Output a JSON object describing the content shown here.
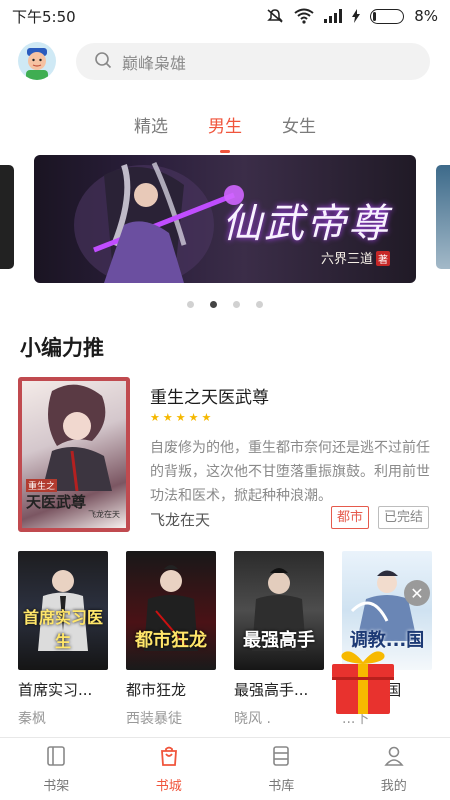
{
  "status_bar": {
    "time": "下午5:50",
    "battery": "8%"
  },
  "search": {
    "placeholder": "巅峰枭雄"
  },
  "tabs": [
    {
      "label": "精选",
      "active": false
    },
    {
      "label": "男生",
      "active": true
    },
    {
      "label": "女生",
      "active": false
    }
  ],
  "banner": {
    "title": "仙武帝尊",
    "subtitle": "六界三道",
    "seal": "著",
    "slides": 4,
    "active_slide": 2
  },
  "section": {
    "title": "小编力推"
  },
  "featured": {
    "title": "重生之天医武尊",
    "rating_stars": 5,
    "description": "自废修为的他，重生都市奈何还是逃不过前任的背叛，这次他不甘堕落重振旗鼓。利用前世功法和医术，掀起种种浪潮。",
    "author": "飞龙在天",
    "tags": [
      "都市",
      "已完结"
    ],
    "cover": {
      "tag": "重生之",
      "title": "天医武尊",
      "author": "飞龙在天"
    }
  },
  "books": [
    {
      "name": "首席实习...",
      "author": "秦枫",
      "cover_text": "首席实习医生"
    },
    {
      "name": "都市狂龙",
      "author": "西装暴徒",
      "cover_text": "都市狂龙"
    },
    {
      "name": "最强高手...",
      "author": "晓风 .",
      "cover_text": "最强高手"
    },
    {
      "name": "调教...国",
      "author": "...下",
      "cover_text": "调教...国"
    }
  ],
  "bottom_nav": [
    {
      "label": "书架",
      "icon": "bookshelf-icon",
      "active": false
    },
    {
      "label": "书城",
      "icon": "bookstore-icon",
      "active": true
    },
    {
      "label": "书库",
      "icon": "library-icon",
      "active": false
    },
    {
      "label": "我的",
      "icon": "profile-icon",
      "active": false
    }
  ],
  "colors": {
    "accent": "#f0553c",
    "tag_red": "#e55a4c",
    "star": "#f5b800"
  }
}
